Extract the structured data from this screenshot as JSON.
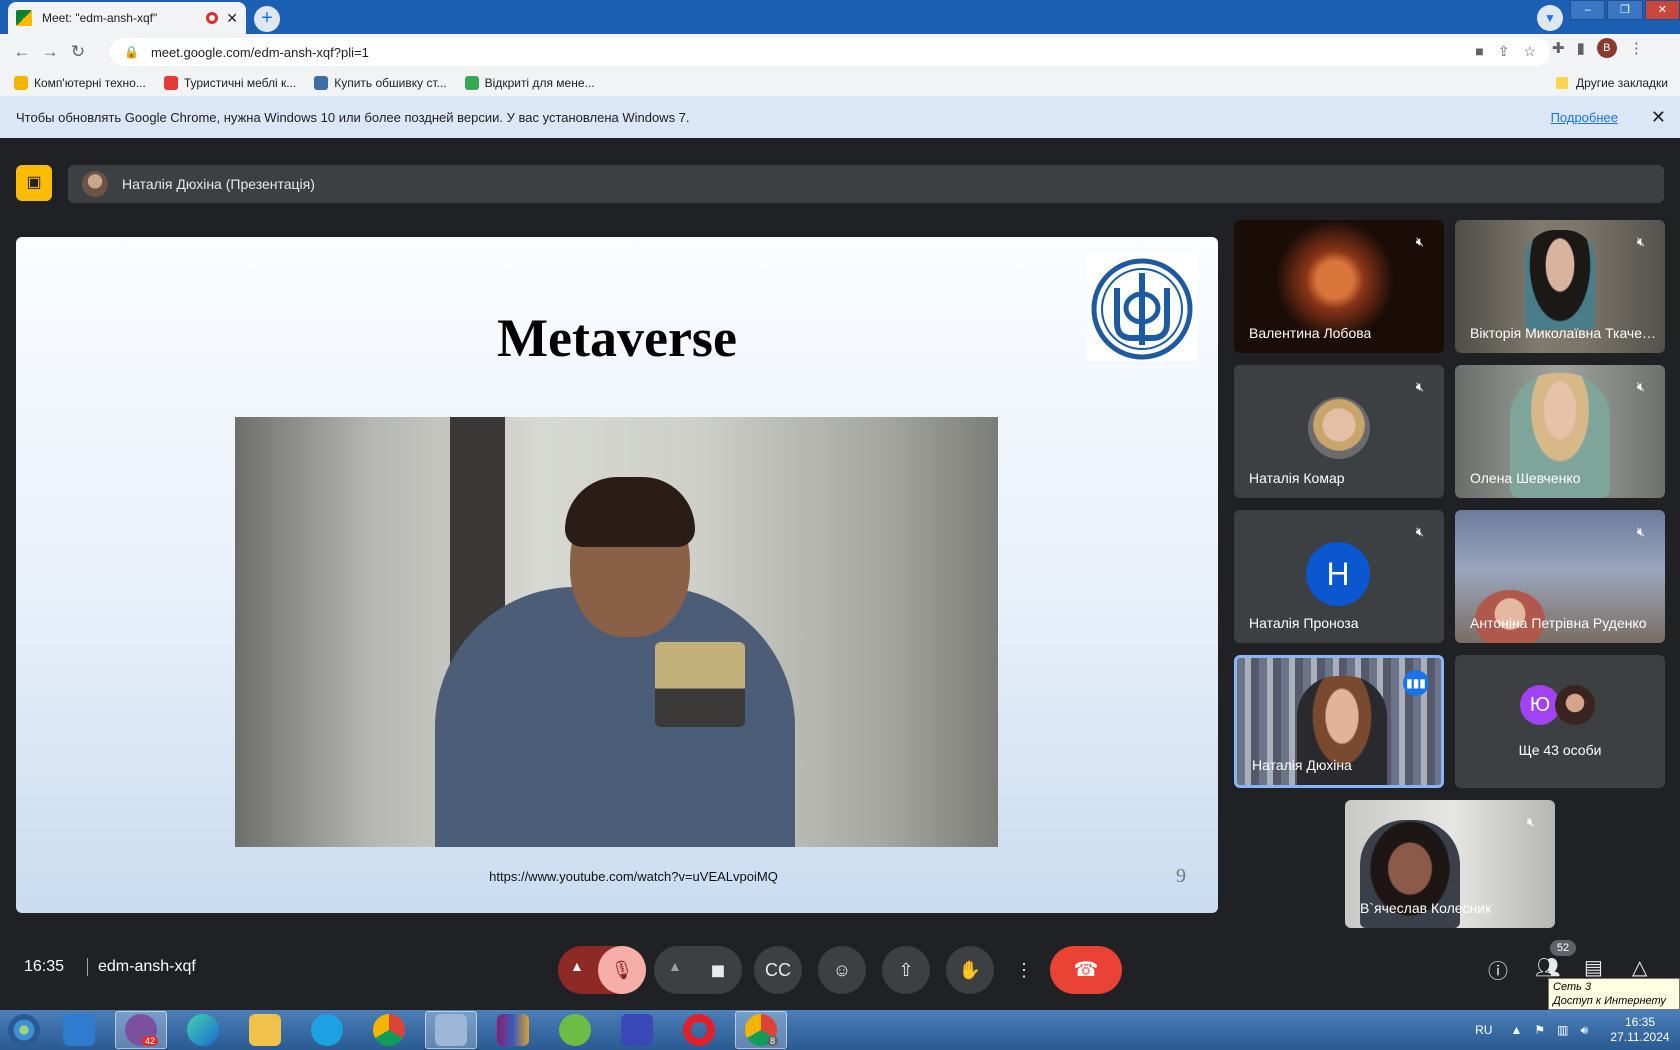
{
  "browser": {
    "tab_title": "Meet: \"edm-ansh-xqf\"",
    "tab_close": "✕",
    "new_tab": "+",
    "url": "meet.google.com/edm-ansh-xqf?pli=1",
    "profile_letter": "B",
    "bookmarks": [
      {
        "label": "Комп'ютерні техно...",
        "color": "#f4b400"
      },
      {
        "label": "Туристичні меблі к...",
        "color": "#e53935"
      },
      {
        "label": "Купить обшивку ст...",
        "color": "#3a6ea5"
      },
      {
        "label": "Відкриті для мене...",
        "color": "#34a853"
      }
    ],
    "other_bookmarks": "Другие закладки",
    "infobar_text": "Чтобы обновлять Google Chrome, нужна Windows 10 или более поздней версии. У вас установлена Windows 7.",
    "infobar_link": "Подробнее"
  },
  "meet": {
    "presenter_label": "Наталія Дюхіна (Презентація)",
    "slide": {
      "title": "Metaverse",
      "url": "https://www.youtube.com/watch?v=uVEALvpoiMQ",
      "page_number": "9"
    },
    "participants": [
      {
        "name": "Валентина Лобова",
        "muted": true
      },
      {
        "name": "Вікторія Миколаївна Ткаченко",
        "muted": true
      },
      {
        "name": "Наталія Комар",
        "muted": true
      },
      {
        "name": "Олена Шевченко",
        "muted": true
      },
      {
        "name": "Наталія Проноза",
        "muted": true,
        "avatar_letter": "Н"
      },
      {
        "name": "Антоніна Петрівна Руденко",
        "muted": true
      },
      {
        "name": "Наталія Дюхіна",
        "muted": false,
        "speaking": true
      },
      {
        "name": "В`ячеслав Колесник",
        "muted": true
      }
    ],
    "more_people": {
      "label": "Ще 43 особи",
      "avatar_letter": "Ю"
    },
    "clock": "16:35",
    "meeting_code": "edm-ansh-xqf",
    "participant_count": "52"
  },
  "tooltip": {
    "line1": "Сеть 3",
    "line2": "Доступ к Интернету"
  },
  "taskbar": {
    "viber_badge": "42",
    "chrome_badge": "8",
    "lang": "RU",
    "time": "16:35",
    "date": "27.11.2024"
  },
  "colors": {
    "accent": "#1a73e8",
    "leave": "#ea4335",
    "muted_bg": "#f6aea9"
  }
}
